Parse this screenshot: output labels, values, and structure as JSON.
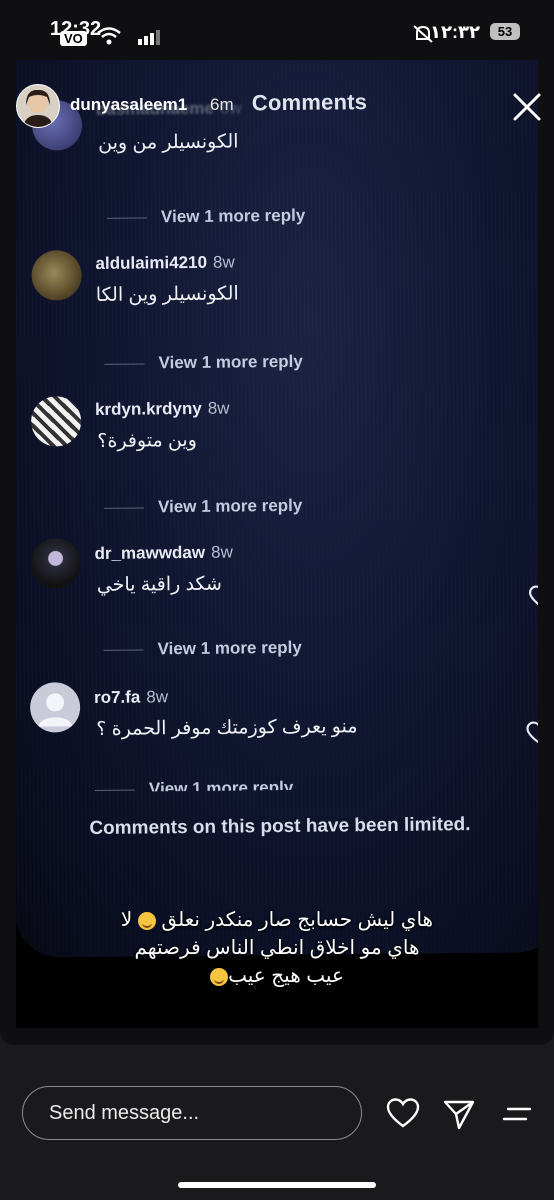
{
  "status_bar": {
    "time": "12:32",
    "lang_badge": "VO",
    "right_text": "١٢:٣٢",
    "battery": "53"
  },
  "story": {
    "username": "dunyasaleem1",
    "time_ago": "6m"
  },
  "inner": {
    "title": "Comments",
    "comments": [
      {
        "user": "basmadnaeme",
        "ago": "8w",
        "text": "الكونسيلر من وين",
        "view_more": "View 1 more reply"
      },
      {
        "user": "aldulaimi4210",
        "ago": "8w",
        "text": "الكونسيلر وين الكا",
        "view_more": "View 1 more reply"
      },
      {
        "user": "krdyn.krdyny",
        "ago": "8w",
        "text": "وين متوفرة؟",
        "view_more": "View 1 more reply"
      },
      {
        "user": "dr_mawwdaw",
        "ago": "8w",
        "text": "شكد راقية ياخي",
        "view_more": "View 1 more reply"
      },
      {
        "user": "ro7.fa",
        "ago": "8w",
        "text": "منو يعرف كوزمتك موفر الحمرة ؟",
        "view_more": "View 1 more reply"
      }
    ],
    "limited_notice": "Comments on this post have been limited."
  },
  "caption": {
    "line1": "هاي ليش حسابج صار منكدر نعلق",
    "line1_end": "لا",
    "line2": "هاي مو اخلاق انطي الناس فرصتهم",
    "line3": "عيب هيج عيب"
  },
  "bottom_bar": {
    "placeholder": "Send message..."
  },
  "icons": [
    "close-icon",
    "heart-icon",
    "send-icon",
    "menu-icon",
    "wifi-icon",
    "signal-icon"
  ]
}
